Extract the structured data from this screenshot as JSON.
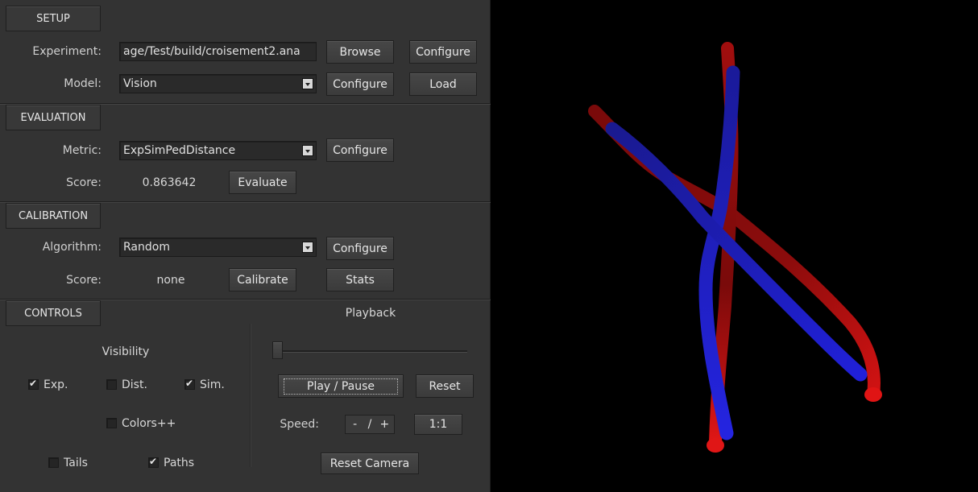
{
  "setup": {
    "tab": "SETUP",
    "experiment_label": "Experiment:",
    "experiment_path": "age/Test/build/croisement2.ana",
    "browse": "Browse",
    "configure_experiment": "Configure",
    "model_label": "Model:",
    "model_value": "Vision",
    "configure_model": "Configure",
    "load": "Load"
  },
  "evaluation": {
    "tab": "EVALUATION",
    "metric_label": "Metric:",
    "metric_value": "ExpSimPedDistance",
    "configure": "Configure",
    "score_label": "Score:",
    "score_value": "0.863642",
    "evaluate": "Evaluate"
  },
  "calibration": {
    "tab": "CALIBRATION",
    "algorithm_label": "Algorithm:",
    "algorithm_value": "Random",
    "configure": "Configure",
    "score_label": "Score:",
    "score_value": "none",
    "calibrate": "Calibrate",
    "stats": "Stats"
  },
  "controls": {
    "tab": "CONTROLS",
    "visibility_label": "Visibility",
    "exp": {
      "label": "Exp.",
      "checked": true
    },
    "dist": {
      "label": "Dist.",
      "checked": false
    },
    "sim": {
      "label": "Sim.",
      "checked": true
    },
    "colors": {
      "label": "Colors++",
      "checked": false
    },
    "tails": {
      "label": "Tails",
      "checked": false
    },
    "paths": {
      "label": "Paths",
      "checked": true
    },
    "playback_label": "Playback",
    "playback_position": 0.0,
    "play_pause": "Play / Pause",
    "reset": "Reset",
    "speed_label": "Speed:",
    "speed_minus": "-",
    "speed_sep": "/",
    "speed_plus": "+",
    "speed_ratio": "1:1",
    "reset_camera": "Reset Camera"
  },
  "viewport": {
    "background": "#000000",
    "experiment_color": "#c01010",
    "simulation_color": "#1a1ac8"
  }
}
